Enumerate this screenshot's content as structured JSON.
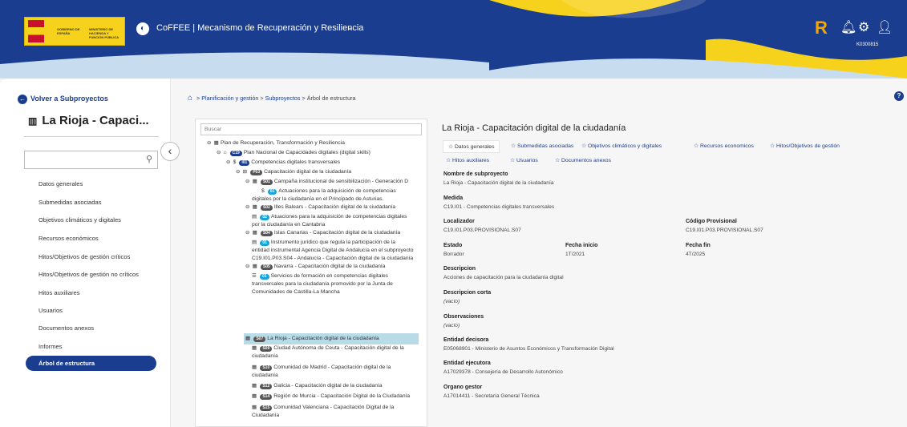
{
  "header": {
    "logo_line1": "GOBIERNO DE ESPAÑA",
    "logo_line2": "MINISTERIO DE HACIENDA Y FUNCIÓN PÚBLICA",
    "app_title": "CoFFEE  |  Mecanismo de Recuperación y Resiliencia",
    "user_id": "K0300815",
    "brand_mark": "R",
    "colors": {
      "header": "#1b3d8f",
      "wave_yellow": "#f7d21c",
      "wave_light": "#c7dcee",
      "accent": "#1aa3d6"
    }
  },
  "sidebar": {
    "back_label": "Volver a Subproyectos",
    "title": "La Rioja - Capaci...",
    "search_value": "",
    "items": [
      {
        "label": "Datos generales"
      },
      {
        "label": "Submedidas asociadas"
      },
      {
        "label": "Objetivos climáticos y digitales"
      },
      {
        "label": "Recursos económicos"
      },
      {
        "label": "Hitos/Objetivos de gestión críticos"
      },
      {
        "label": "Hitos/Objetivos de gestión no críticos"
      },
      {
        "label": "Hitos auxiliares"
      },
      {
        "label": "Usuarios"
      },
      {
        "label": "Documentos anexos"
      },
      {
        "label": "Informes"
      },
      {
        "label": "Árbol de estructura",
        "active": true
      }
    ]
  },
  "breadcrumb": {
    "sep": ">",
    "items": [
      "Planificación y gestión",
      "Subproyectos"
    ],
    "current": "Árbol de estructura"
  },
  "tree": {
    "search_placeholder": "Buscar",
    "nodes": [
      {
        "toggle": "⊖",
        "icon": "▦",
        "badge": "",
        "text": "Plan de Recuperación, Transformación y Resiliencia"
      },
      {
        "toggle": "⊖",
        "icon": "⌂",
        "badge": "C19",
        "text": "Plan Nacional de Capacidades digitales (digital skills)"
      },
      {
        "toggle": "⊖",
        "icon": "$",
        "badge": "I01",
        "text": "Competencias digitales transversales"
      },
      {
        "toggle": "⊖",
        "icon": "⊞",
        "badge": "P03",
        "text": "Capacitación digital de la ciudadanía"
      },
      {
        "toggle": "⊖",
        "icon": "▦",
        "badge": "S01",
        "text": "Campaña institucional de sensibilización - Generación D"
      },
      {
        "toggle": "",
        "icon": "$",
        "badge": "01",
        "text": "Actuaciones para la adquisición de competencias"
      },
      {
        "toggle": "",
        "icon": "",
        "badge": "",
        "text": "digitales por la ciudadanía en el Principado de Asturias."
      },
      {
        "toggle": "⊖",
        "icon": "▦",
        "badge": "S02",
        "text": "Illes Balears - Capacitación digital de la ciudadanía"
      },
      {
        "toggle": "",
        "icon": "▤",
        "badge": "02",
        "text": "Atuaciones para la adquisición de competencias digitales"
      },
      {
        "toggle": "",
        "icon": "",
        "badge": "",
        "text": "por la ciudadanía en Cantabria"
      },
      {
        "toggle": "⊖",
        "icon": "▦",
        "badge": "S04",
        "text": "Islas Canarias - Capacitación digital de la ciudadanía"
      },
      {
        "toggle": "",
        "icon": "▤",
        "badge": "01",
        "text": "Instrumento jurídico que regula la participación de la"
      },
      {
        "toggle": "",
        "icon": "",
        "badge": "",
        "text": "entidad instrumental Agencia Digital de Andalucía en el subproyecto"
      },
      {
        "toggle": "",
        "icon": "",
        "badge": "",
        "text": "C19.I01.P03.S04 - Andalucía - Capacitación digital de la ciudadanía"
      },
      {
        "toggle": "⊖",
        "icon": "▦",
        "badge": "S05",
        "text": "Navarra - Capacitación digital de la ciudadanía"
      },
      {
        "toggle": "",
        "icon": "☰",
        "badge": "01",
        "text": "Servicios de formación en competencias digitales"
      },
      {
        "toggle": "",
        "icon": "",
        "badge": "",
        "text": "transversales para la ciudadanía promovido por la Junta de"
      },
      {
        "toggle": "",
        "icon": "",
        "badge": "",
        "text": "Comunidades de Castilla-La Mancha"
      },
      {
        "toggle": "",
        "icon": "▦",
        "badge": "S07",
        "text": "La Rioja - Capacitación digital de la ciudadanía"
      },
      {
        "toggle": "",
        "icon": "▦",
        "badge": "S09",
        "text": "Ciudad Autónoma de Ceuta - Capacitación digital de la"
      },
      {
        "toggle": "",
        "icon": "",
        "badge": "",
        "text": "ciudadanía"
      },
      {
        "toggle": "",
        "icon": "▦",
        "badge": "S10",
        "text": "Comunidad de Madrid - Capacitación digital de la"
      },
      {
        "toggle": "",
        "icon": "",
        "badge": "",
        "text": "ciudadanía"
      },
      {
        "toggle": "",
        "icon": "▦",
        "badge": "S12",
        "text": "Galicia - Capacitación digital de la ciudadanía"
      },
      {
        "toggle": "",
        "icon": "▦",
        "badge": "S14",
        "text": "Región de Murcia - Capacitación Digital de la Ciudadanía"
      },
      {
        "toggle": "",
        "icon": "▦",
        "badge": "S15",
        "text": "Comunidad Valenciana - Capacitación Digital de la"
      },
      {
        "toggle": "",
        "icon": "",
        "badge": "",
        "text": "Ciudadanía"
      }
    ]
  },
  "detail": {
    "title": "La Rioja - Capacitación digital de la ciudadanía",
    "tabs": [
      {
        "label": "Datos generales",
        "active": true
      },
      {
        "label": "Submedidas asociadas"
      },
      {
        "label": "Objetivos climáticos y digitales"
      },
      {
        "label": "Recursos economicos"
      },
      {
        "label": "Hitos/Objetivos de gestión"
      },
      {
        "label": "Hitos auxiliares"
      },
      {
        "label": "Usuarios"
      },
      {
        "label": "Documentos anexos"
      }
    ],
    "fields": {
      "nombre_label": "Nombre de subproyecto",
      "nombre_value": "La Rioja - Capacitación digital de la ciudadanía",
      "medida_label": "Medida",
      "medida_value": "C19.I01 - Competencias digitales transversales",
      "localizador_label": "Localizador",
      "localizador_value": "C19.I01.P03.PROVISIONAL.S07",
      "codigo_label": "Código Provisional",
      "codigo_value": "C19.I01.P03.PROVISIONAL.S07",
      "estado_label": "Estado",
      "estado_value": "Borrador",
      "inicio_label": "Fecha inicio",
      "inicio_value": "1T/2021",
      "fin_label": "Fecha fin",
      "fin_value": "4T/2025",
      "desc_label": "Descripcion",
      "desc_value": "Acciones de capacitación para la ciudadanía digital",
      "desc_corta_label": "Descripcion corta",
      "desc_corta_value": "(vacío)",
      "obs_label": "Observaciones",
      "obs_value": "(vacío)",
      "decisora_label": "Entidad decisora",
      "decisora_value": "E05068901 - Ministerio de Asuntos Económicos y Transformación Digital",
      "ejecutora_label": "Entidad ejecutora",
      "ejecutora_value": "A17029378 - Consejería de Desarrollo Autonómico",
      "gestor_label": "Organo gestor",
      "gestor_value": "A17014411 - Secretaría General Técnica"
    }
  }
}
